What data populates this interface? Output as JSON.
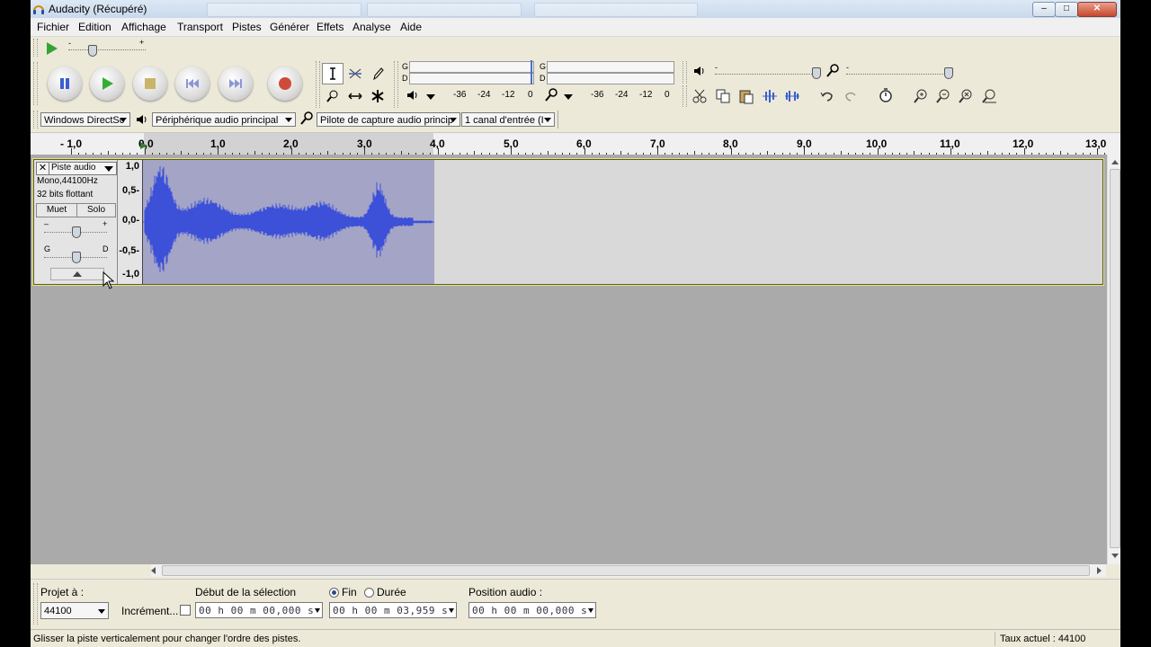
{
  "window": {
    "title": "Audacity (Récupéré)"
  },
  "menu": [
    "Fichier",
    "Edition",
    "Affichage",
    "Transport",
    "Pistes",
    "Générer",
    "Effets",
    "Analyse",
    "Aide"
  ],
  "meters": {
    "playback_channels": [
      "G",
      "D"
    ],
    "record_channels": [
      "G",
      "D"
    ],
    "scale": [
      "-36",
      "-24",
      "-12",
      "0"
    ]
  },
  "devices": {
    "host": "Windows DirectSc",
    "output": "Périphérique audio principal",
    "input": "Pilote de capture audio princip",
    "channels": "1 canal d'entrée (I"
  },
  "ruler": {
    "labels": [
      "- 1,0",
      "0,0",
      "1,0",
      "2,0",
      "3,0",
      "4,0",
      "5,0",
      "6,0",
      "7,0",
      "8,0",
      "9,0",
      "10,0",
      "11,0",
      "12,0",
      "13,0"
    ]
  },
  "track": {
    "name": "Piste audio",
    "format": "Mono,44100Hz",
    "bits": "32 bits flottant",
    "mute_label": "Muet",
    "solo_label": "Solo",
    "gain_minus": "–",
    "gain_plus": "+",
    "pan_left": "G",
    "pan_right": "D",
    "scale": [
      "1,0",
      "0,5-",
      "0,0-",
      "-0,5-",
      "-1,0"
    ]
  },
  "selection": {
    "project_rate_label": "Projet à :",
    "project_rate": "44100",
    "snap_label": "Incrément...",
    "start_label": "Début de la sélection",
    "end_label": "Fin",
    "length_label": "Durée",
    "start_value": "00 h 00 m 00,000 s",
    "end_value": "00 h 00 m 03,959 s",
    "audio_position_label": "Position audio :",
    "audio_position_value": "00 h 00 m 00,000 s"
  },
  "status": {
    "message": "Glisser la piste verticalement pour changer l'ordre des pistes.",
    "rate": "Taux actuel : 44100"
  }
}
